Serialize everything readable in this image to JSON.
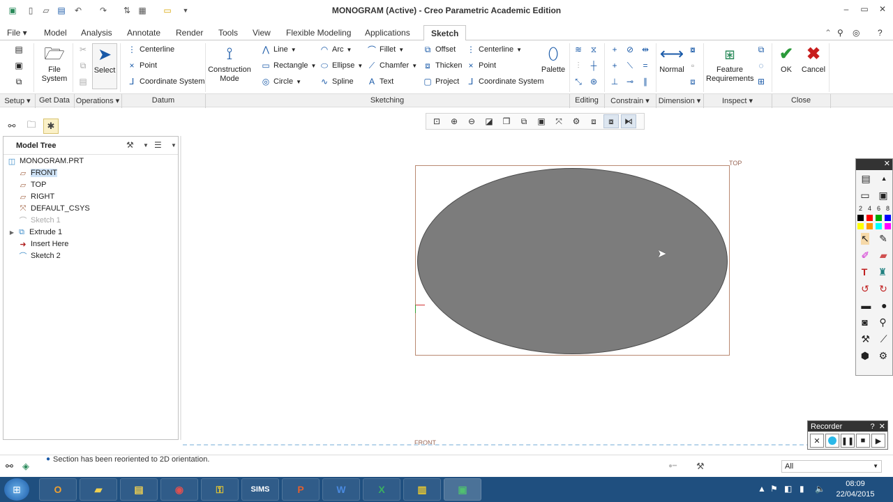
{
  "window": {
    "title": "MONOGRAM (Active) - Creo Parametric Academic Edition",
    "controls": [
      "–",
      "▭",
      "✕"
    ]
  },
  "quick_access": [
    "app-icon",
    "new-icon",
    "open-icon",
    "save-icon",
    "undo-icon",
    "redo-icon",
    "regenerate-icon",
    "windows-icon",
    "close-window-icon",
    "customize-icon"
  ],
  "tabs": [
    {
      "label": "File ▾"
    },
    {
      "label": "Model"
    },
    {
      "label": "Analysis"
    },
    {
      "label": "Annotate"
    },
    {
      "label": "Render"
    },
    {
      "label": "Tools"
    },
    {
      "label": "View"
    },
    {
      "label": "Flexible Modeling"
    },
    {
      "label": "Applications"
    },
    {
      "label": "Sketch"
    }
  ],
  "ribbon": {
    "file_system": "File\nSystem",
    "select": "Select",
    "datum": {
      "centerline": "Centerline",
      "point": "Point",
      "coordinate_system": "Coordinate System"
    },
    "construction_mode": "Construction\nMode",
    "sketching": {
      "line": "Line",
      "rectangle": "Rectangle",
      "circle": "Circle",
      "arc": "Arc",
      "ellipse": "Ellipse",
      "spline": "Spline",
      "fillet": "Fillet",
      "chamfer": "Chamfer",
      "text": "Text",
      "offset": "Offset",
      "thicken": "Thicken",
      "project": "Project",
      "centerline": "Centerline",
      "point": "Point",
      "coordinate_system": "Coordinate System",
      "palette": "Palette"
    },
    "normal": "Normal",
    "feature_requirements": "Feature\nRequirements",
    "ok": "OK",
    "cancel": "Cancel"
  },
  "groups": {
    "setup": "Setup ▾",
    "get_data": "Get Data",
    "operations": "Operations ▾",
    "datum": "Datum",
    "sketching": "Sketching",
    "editing": "Editing",
    "constrain": "Constrain ▾",
    "dimension": "Dimension ▾",
    "inspect": "Inspect ▾",
    "close": "Close"
  },
  "model_tree": {
    "title": "Model Tree",
    "items": [
      {
        "label": "MONOGRAM.PRT",
        "icon": "part-icon",
        "expand": ""
      },
      {
        "label": "FRONT",
        "icon": "datum-plane-icon",
        "expand": ""
      },
      {
        "label": "TOP",
        "icon": "datum-plane-icon",
        "expand": ""
      },
      {
        "label": "RIGHT",
        "icon": "datum-plane-icon",
        "expand": ""
      },
      {
        "label": "DEFAULT_CSYS",
        "icon": "csys-icon",
        "expand": ""
      },
      {
        "label": "Sketch 1",
        "icon": "sketch-icon",
        "expand": ""
      },
      {
        "label": "Extrude 1",
        "icon": "extrude-icon",
        "expand": "▶"
      },
      {
        "label": "Insert Here",
        "icon": "insert-arrow-icon",
        "expand": ""
      },
      {
        "label": "Sketch 2",
        "icon": "sketch-icon",
        "expand": ""
      }
    ]
  },
  "canvas": {
    "top_label": "TOP",
    "front_label": "FRONT"
  },
  "status": {
    "message": "Section has been reoriented to 2D orientation.",
    "filter": "All"
  },
  "taskbar": {
    "apps": [
      "",
      "",
      "",
      "",
      "",
      "SIMS",
      "",
      "",
      "",
      "",
      ""
    ],
    "time": "08:09",
    "date": "22/04/2015"
  },
  "recorder": {
    "title": "Recorder",
    "help": "?",
    "close": "✕"
  },
  "pen_panel": {
    "widths": [
      "2",
      "4",
      "6",
      "8"
    ],
    "colors": [
      "#000000",
      "#ff0000",
      "#00aa00",
      "#0000ff",
      "#ffff00",
      "#ff9900",
      "#00ffff",
      "#ff00ff"
    ]
  },
  "colors": {
    "sketch_fill": "#7c7c7c",
    "accent_blue": "#1a5aa8",
    "taskbar": "#1f4f7f"
  }
}
